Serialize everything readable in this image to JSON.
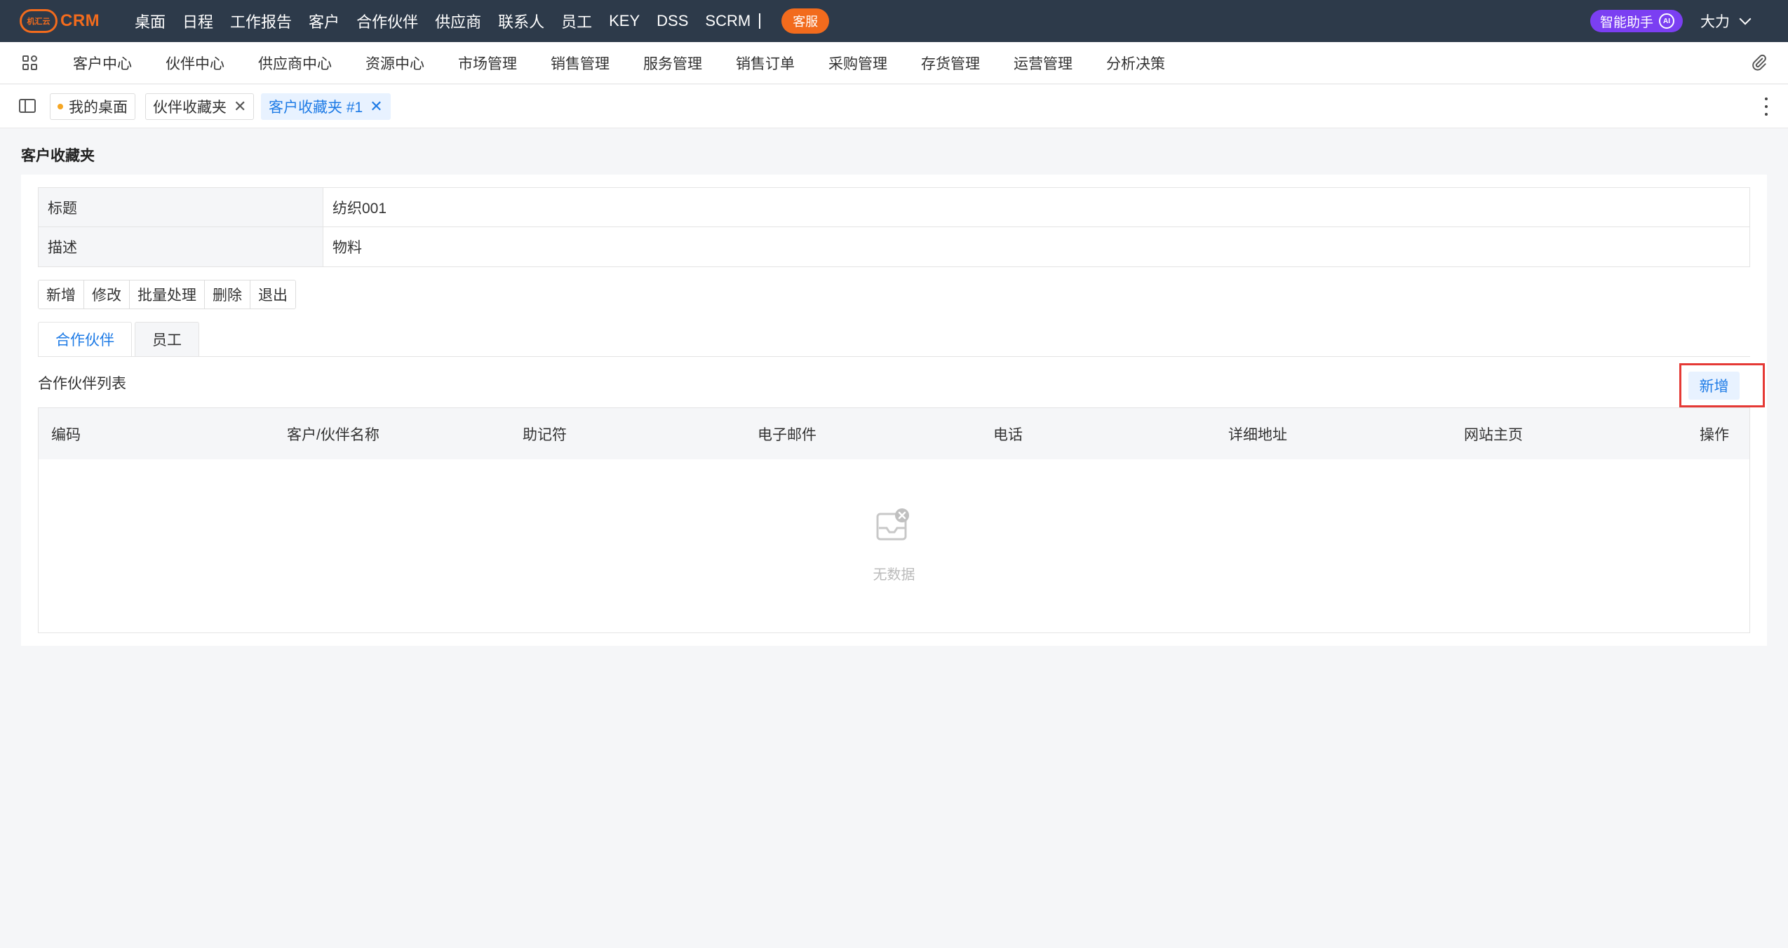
{
  "app": {
    "logo_badge": "机汇云",
    "logo_text": "CRM"
  },
  "topnav": {
    "items": [
      "桌面",
      "日程",
      "工作报告",
      "客户",
      "合作伙伴",
      "供应商",
      "联系人",
      "员工",
      "KEY",
      "DSS",
      "SCRM"
    ],
    "service_label": "客服",
    "ai_label": "智能助手",
    "ai_badge": "AI",
    "user_name": "大力"
  },
  "modnav": {
    "items": [
      "客户中心",
      "伙伴中心",
      "供应商中心",
      "资源中心",
      "市场管理",
      "销售管理",
      "服务管理",
      "销售订单",
      "采购管理",
      "存货管理",
      "运营管理",
      "分析决策"
    ]
  },
  "tabs": [
    {
      "label": "我的桌面",
      "closable": false,
      "active": false
    },
    {
      "label": "伙伴收藏夹",
      "closable": true,
      "active": false
    },
    {
      "label": "客户收藏夹 #1",
      "closable": true,
      "active": true
    }
  ],
  "page": {
    "title": "客户收藏夹",
    "info": [
      {
        "label": "标题",
        "value": "纺织001"
      },
      {
        "label": "描述",
        "value": "物料"
      }
    ],
    "actions": [
      "新增",
      "修改",
      "批量处理",
      "删除",
      "退出"
    ],
    "subtabs": [
      "合作伙伴",
      "员工"
    ],
    "list_title": "合作伙伴列表",
    "add_label": "新增",
    "columns": [
      "编码",
      "客户/伙伴名称",
      "助记符",
      "电子邮件",
      "电话",
      "详细地址",
      "网站主页",
      "操作"
    ],
    "empty_text": "无数据"
  },
  "colors": {
    "topbar_bg": "#2d3a4a",
    "brand": "#f26b1d",
    "accent": "#1e7be6",
    "ai": "#7b3ff2",
    "highlight": "#e53935"
  }
}
